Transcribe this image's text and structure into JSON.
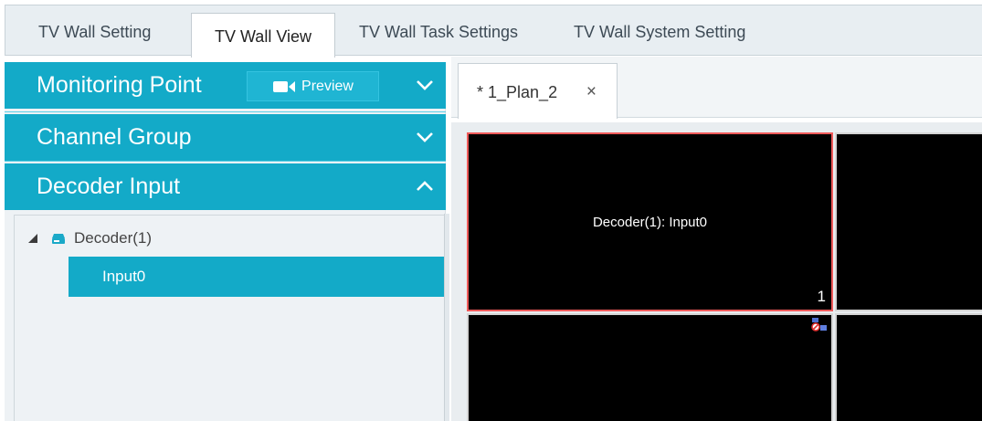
{
  "top_tabs": [
    {
      "label": "TV Wall Setting",
      "active": false
    },
    {
      "label": "TV Wall View",
      "active": true
    },
    {
      "label": "TV Wall Task Settings",
      "active": false
    },
    {
      "label": "TV Wall System Setting",
      "active": false
    }
  ],
  "left_panel": {
    "monitoring_point": {
      "label": "Monitoring Point",
      "preview_label": "Preview",
      "expanded": false
    },
    "channel_group": {
      "label": "Channel Group",
      "expanded": false
    },
    "decoder_input": {
      "label": "Decoder Input",
      "expanded": true
    },
    "tree": {
      "decoder": {
        "label": "Decoder(1)",
        "icon": "decoder-icon",
        "expanded": true
      },
      "inputs": [
        {
          "label": "Input0",
          "selected": true
        }
      ]
    }
  },
  "plan_tab": {
    "label": "* 1_Plan_2",
    "close_label": "×"
  },
  "wall": {
    "cells": [
      {
        "label": "Decoder(1): Input0",
        "number": "1",
        "selected": true
      },
      {
        "label": "",
        "number": "",
        "selected": false
      },
      {
        "label": "",
        "number": "",
        "selected": false,
        "status_icon": "stream-disconnected-icon"
      },
      {
        "label": "",
        "number": "",
        "selected": false
      }
    ]
  },
  "colors": {
    "accent": "#13aac8",
    "selected_cell_border": "#ef5a5a",
    "cell_background": "#000000"
  }
}
